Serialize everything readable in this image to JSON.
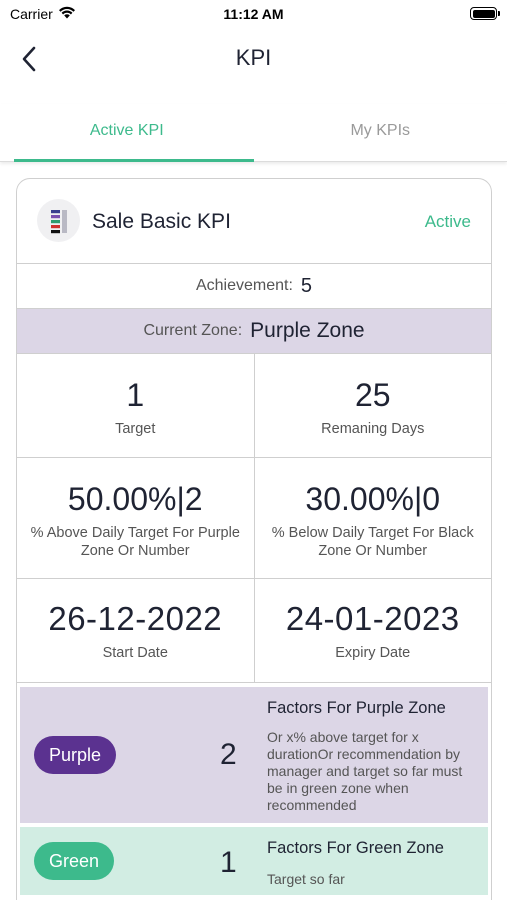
{
  "status_bar": {
    "carrier": "Carrier",
    "time": "11:12 AM"
  },
  "nav": {
    "title": "KPI"
  },
  "tabs": [
    {
      "label": "Active KPI",
      "active": true
    },
    {
      "label": "My KPIs",
      "active": false
    }
  ],
  "kpi": {
    "name": "Sale Basic KPI",
    "status": "Active",
    "achievement_label": "Achievement:",
    "achievement_value": "5",
    "zone_label": "Current Zone:",
    "zone_value": "Purple Zone",
    "target_value": "1",
    "target_label": "Target",
    "remaining_value": "25",
    "remaining_label": "Remaning Days",
    "above_value": "50.00%|2",
    "above_label": "% Above Daily Target For Purple Zone Or Number",
    "below_value": "30.00%|0",
    "below_label": "% Below Daily Target For Black Zone Or Number",
    "start_value": "26-12-2022",
    "start_label": "Start Date",
    "expiry_value": "24-01-2023",
    "expiry_label": "Expiry Date"
  },
  "factors": [
    {
      "pill": "Purple",
      "count": "2",
      "title": "Factors For Purple Zone",
      "desc": "Or x% above target for x durationOr recommendation by manager and target so far must be in green zone when recommended"
    },
    {
      "pill": "Green",
      "count": "1",
      "title": "Factors For Green Zone",
      "desc": "Target so far"
    }
  ],
  "colors": {
    "accent_green": "#3dba8c",
    "purple": "#5b3290",
    "purple_bg": "#dcd6e6",
    "green_bg": "#d2ede3"
  }
}
